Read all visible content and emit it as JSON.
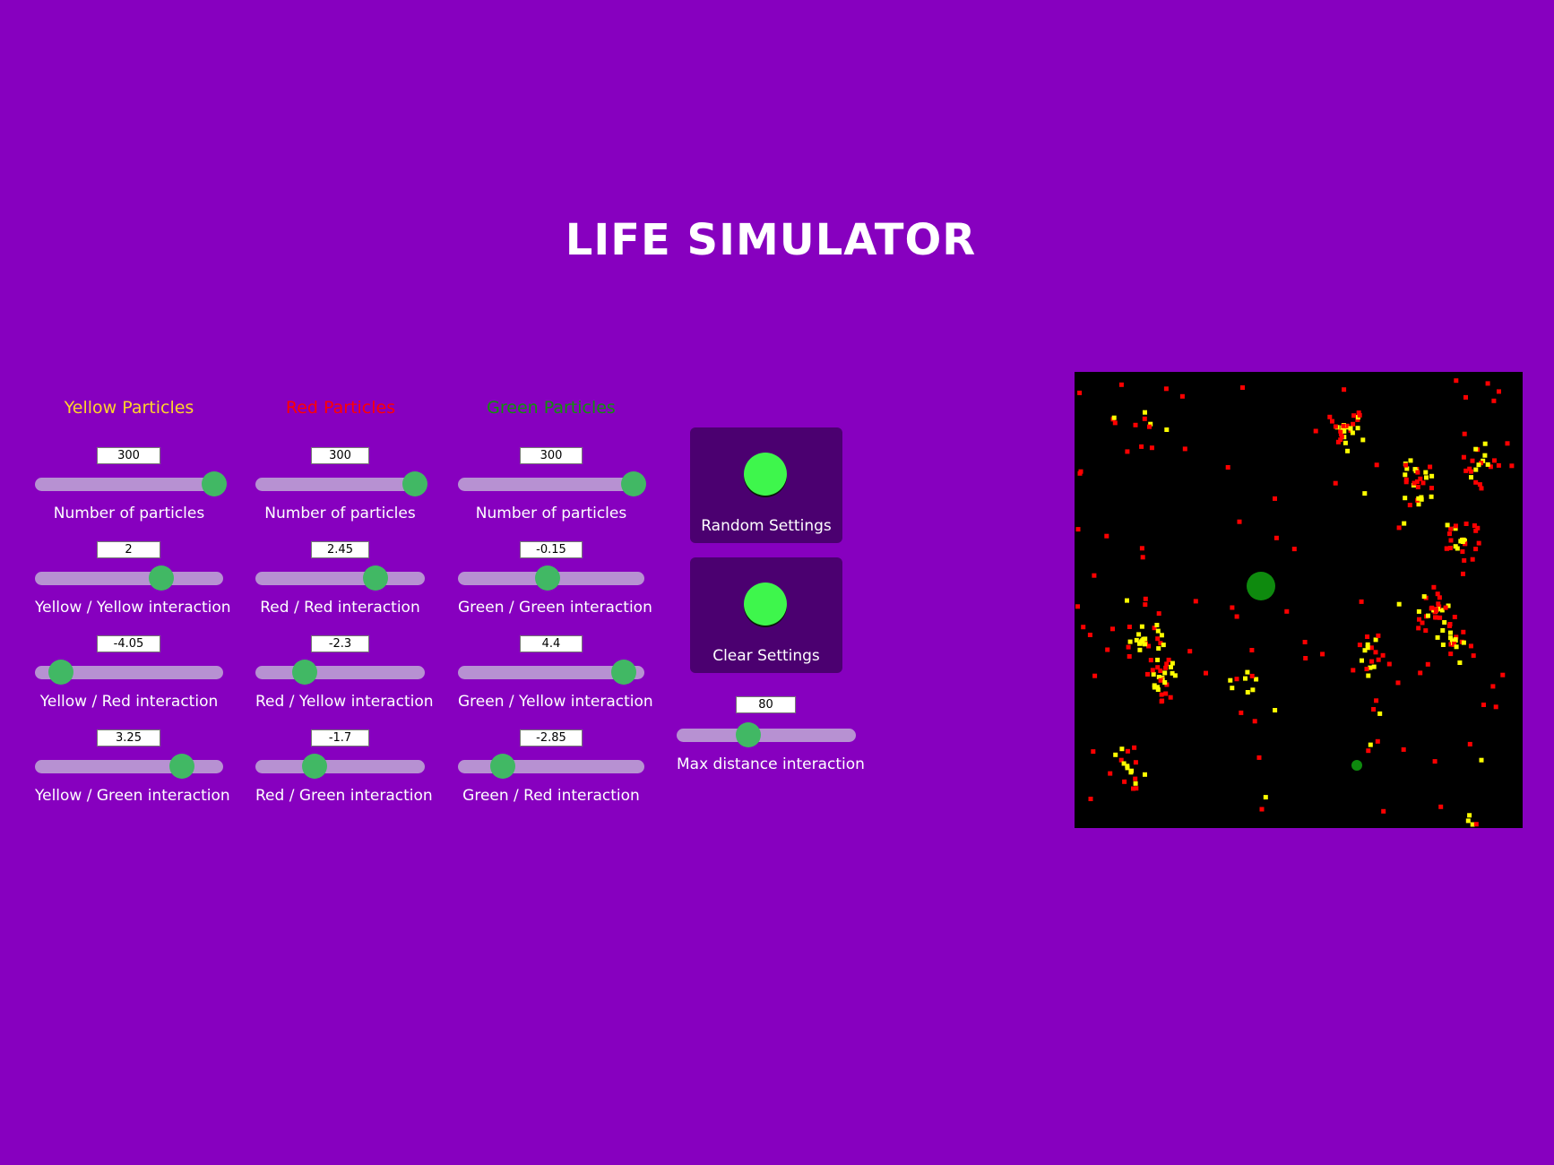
{
  "app": {
    "title": "LIFE SIMULATOR"
  },
  "colors": {
    "background": "#8700bf",
    "yellow": "#ffd42a",
    "red": "#ff0000",
    "green": "#11910b",
    "slider_track": "#b791d2",
    "slider_thumb": "#41b864",
    "button_card": "#4b0070",
    "button_circle": "#3ef64c",
    "canvas": "#000000"
  },
  "yellow": {
    "heading": "Yellow Particles",
    "sliders": [
      {
        "value": "300",
        "label": "Number of particles",
        "level": 0.95
      },
      {
        "value": "2",
        "label": "Yellow / Yellow interaction",
        "level": 0.67
      },
      {
        "value": "-4.05",
        "label": "Yellow / Red interaction",
        "level": 0.14
      },
      {
        "value": "3.25",
        "label": "Yellow / Green interaction",
        "level": 0.78
      }
    ]
  },
  "red": {
    "heading": "Red Particles",
    "sliders": [
      {
        "value": "300",
        "label": "Number of particles",
        "level": 0.94
      },
      {
        "value": "2.45",
        "label": "Red / Red interaction",
        "level": 0.71
      },
      {
        "value": "-2.3",
        "label": "Red / Yellow interaction",
        "level": 0.29
      },
      {
        "value": "-1.7",
        "label": "Red / Green interaction",
        "level": 0.35
      }
    ]
  },
  "green": {
    "heading": "Green Particles",
    "sliders": [
      {
        "value": "300",
        "label": "Number of particles",
        "level": 0.94
      },
      {
        "value": "-0.15",
        "label": "Green / Green interaction",
        "level": 0.48
      },
      {
        "value": "4.4",
        "label": "Green / Yellow interaction",
        "level": 0.89
      },
      {
        "value": "-2.85",
        "label": "Green / Red interaction",
        "level": 0.24
      }
    ]
  },
  "controls": {
    "random_label": "Random Settings",
    "clear_label": "Clear Settings",
    "max_distance": {
      "value": "80",
      "label": "Max distance interaction",
      "level": 0.4
    }
  }
}
